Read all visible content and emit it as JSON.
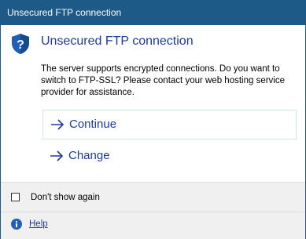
{
  "window": {
    "title": "Unsecured FTP connection"
  },
  "dialog": {
    "heading": "Unsecured FTP connection",
    "message": "The server supports encrypted connections. Do you want to switch to FTP-SSL? Please contact your web hosting service provider for assistance.",
    "icon": "shield-question-icon"
  },
  "commands": [
    {
      "label": "Continue",
      "icon": "arrow-right-icon"
    },
    {
      "label": "Change",
      "icon": "arrow-right-icon"
    }
  ],
  "footer": {
    "checkbox_label": "Don't show again",
    "checkbox_checked": false,
    "help_label": "Help",
    "help_icon": "info-icon"
  },
  "colors": {
    "titlebar": "#1e5a87",
    "accent_text": "#1e3a99",
    "shield": "#1f5fb5",
    "footer_bg": "#f0f0f0"
  }
}
